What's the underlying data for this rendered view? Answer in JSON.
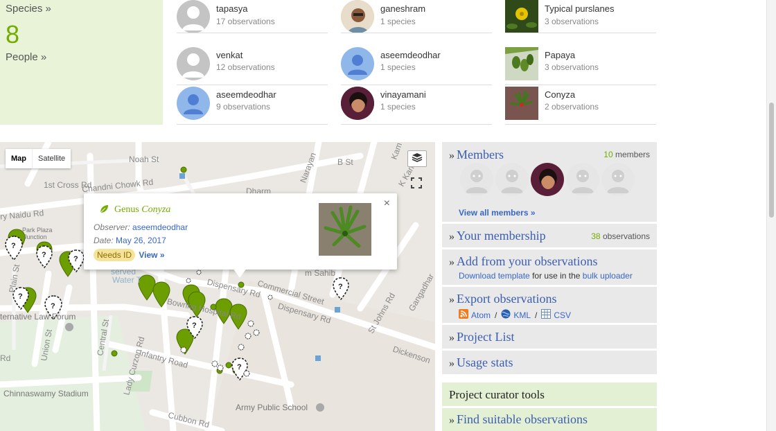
{
  "stats": {
    "species_link": "Species »",
    "people_count": "8",
    "people_link": "People »"
  },
  "observers": [
    {
      "name": "tapasya",
      "count": "17 observations"
    },
    {
      "name": "venkat",
      "count": "12 observations"
    },
    {
      "name": "aseemdeodhar",
      "count": "9 observations"
    }
  ],
  "species_people": [
    {
      "name": "ganeshram",
      "count": "1 species"
    },
    {
      "name": "aseemdeodhar",
      "count": "1 species"
    },
    {
      "name": "vinayamani",
      "count": "1 species"
    }
  ],
  "top_species": [
    {
      "name": "Typical purslanes",
      "count": "3 observations"
    },
    {
      "name": "Papaya",
      "count": "3 observations"
    },
    {
      "name": "Conyza",
      "count": "2 observations"
    }
  ],
  "map": {
    "type_map": "Map",
    "type_satellite": "Satellite",
    "labels": {
      "noah": "Noah St",
      "cross": "1st Cross Rd",
      "chandni": "Chandni Chowk Rd",
      "naidu": "ry Naidu Rd",
      "parkplaza": "Park Plaza",
      "junction": "Junction",
      "plain": "Plain St",
      "lawforum": "ternative Law Forum",
      "union": "Union St",
      "central": "Central St",
      "curzon": "Lady Curzon Rd",
      "infantry": "Infantry Road",
      "stadium": "Chinnaswamy Stadium",
      "cubbon": "Cubbon Rd",
      "army": "Army Public School",
      "dispensary1": "Dispensary Rd",
      "dispensary2": "Dispensary Rd",
      "commercial": "Commercial Street",
      "bowring": "Bowring Hospital Rd",
      "stjohns": "St Johns Rd",
      "dickenson": "Dickenson",
      "gangadhar": "Gangadhar",
      "bst": "B St",
      "narayan": "Narayan",
      "kam": "Kam",
      "kand": "K Kan",
      "sahib": "m Sahib",
      "dharm": "Dharm",
      "reserved": "served",
      "water": "Water T",
      "rd": "Rd"
    },
    "popup": {
      "title_prefix": "Genus",
      "title_taxon": "Conyza",
      "observer_label": "Observer:",
      "observer_value": "aseemdeodhar",
      "date_label": "Date:",
      "date_value": "May 26, 2017",
      "badge": "Needs ID",
      "view_link": "View »",
      "close": "×"
    }
  },
  "sidebar": {
    "members": {
      "title": "Members",
      "count": "10",
      "count_suffix": "members",
      "view_all": "View all members »"
    },
    "membership": {
      "title": "Your membership",
      "count": "38",
      "count_suffix": "observations"
    },
    "add_from": {
      "title": "Add from your observations",
      "download_template": "Download template",
      "middle": "for use in the",
      "bulk_uploader": "bulk uploader"
    },
    "export": {
      "title": "Export observations",
      "atom": "Atom",
      "kml": "KML",
      "csv": "CSV",
      "sep": "/"
    },
    "project_list": {
      "title": "Project List"
    },
    "usage_stats": {
      "title": "Usage stats"
    },
    "curator": {
      "title": "Project curator tools"
    },
    "find_suitable": {
      "title": "Find suitable observations"
    },
    "chevron": "»"
  },
  "colors": {
    "accent_green": "#74ac00",
    "link_blue": "#3b5eb0",
    "panel_green": "#e8f3d8",
    "sidebar_grey": "#e9e9e9"
  }
}
